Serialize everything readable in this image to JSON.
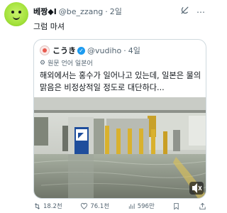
{
  "tweet": {
    "author_name": "베짱◆I",
    "handle": "@be_zzang",
    "separator": "·",
    "time": "2일",
    "text": "그럼 마셔"
  },
  "quote": {
    "author_name": "こうき",
    "handle": "@vudiho",
    "separator": "·",
    "time": "4일",
    "translate_label": "원문 언어 일본어",
    "text": "해외에서는 홍수가 일어나고 있는데, 일본은 물의 맑음은 비정상적일 정도로 대단하다..."
  },
  "metrics": {
    "retweets": "18.2천",
    "likes": "76.1천",
    "views": "596만"
  },
  "icons": {
    "grok": "grok-icon",
    "more": "more-icon",
    "verified": "verified-badge-icon",
    "translate": "translate-icon",
    "mute": "mute-icon",
    "retweet": "retweet-icon",
    "like": "heart-icon",
    "views": "views-chart-icon",
    "bookmark": "bookmark-icon",
    "share": "share-icon"
  },
  "colors": {
    "accent": "#1d9bf0",
    "secondary_text": "#536471",
    "border": "#cfd9de"
  }
}
